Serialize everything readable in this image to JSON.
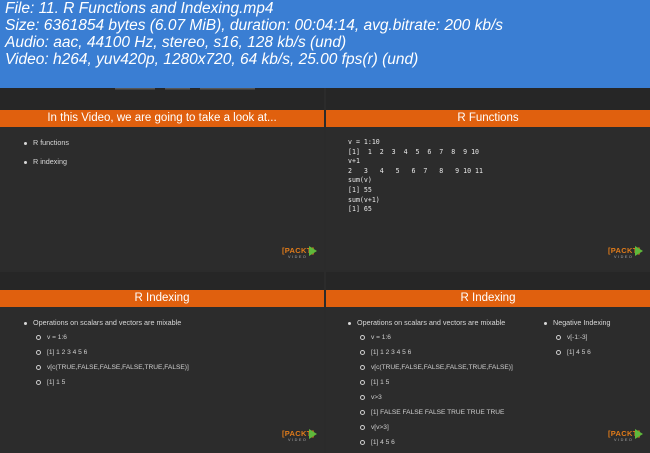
{
  "info": {
    "file": "File: 11. R Functions and Indexing.mp4",
    "size": "Size: 6361854 bytes (6.07 MiB), duration: 00:04:14, avg.bitrate: 200 kb/s",
    "audio": "Audio: aac, 44100 Hz, stereo, s16, 128 kb/s (und)",
    "video": "Video: h264, yuv420p, 1280x720, 64 kb/s, 25.00 fps(r) (und)"
  },
  "slides": [
    {
      "title": "In this Video, we are going to take a look at...",
      "bullets": [
        "R functions",
        "R indexing"
      ]
    },
    {
      "title": "R Functions",
      "code": "v = 1:10\n[1]  1  2  3  4  5  6  7  8  9 10\nv+1\n2   3   4   5   6  7   8   9 10 11\nsum(v)\n[1] 55\nsum(v+1)\n[1] 65"
    },
    {
      "title": "R Indexing",
      "bullet": "Operations on scalars and vectors are mixable",
      "subs": [
        "v = 1:6",
        "[1] 1 2 3 4 5 6",
        "v[c(TRUE,FALSE,FALSE,FALSE,TRUE,FALSE)]",
        "[1] 1 5"
      ]
    },
    {
      "title": "R Indexing",
      "bullet": "Operations on scalars and vectors are mixable",
      "subs": [
        "v = 1:6",
        "[1] 1 2 3 4 5 6",
        "v[c(TRUE,FALSE,FALSE,FALSE,TRUE,FALSE)]",
        "[1] 1 5",
        "v>3",
        "[1] FALSE FALSE FALSE  TRUE  TRUE  TRUE",
        "v[v>3]",
        "[1] 4 5 6"
      ],
      "bullet2": "Negative Indexing",
      "subs2": [
        "v[-1:-3]",
        "[1] 4 5 6"
      ]
    }
  ],
  "logo": {
    "text": "[PACKT]",
    "sub": "VIDEO"
  },
  "colors": {
    "accent": "#e0600e",
    "header_bg": "#3a7ed3",
    "slide_bg": "#2c2c2c",
    "logo_arrow": "#5fb93b"
  }
}
